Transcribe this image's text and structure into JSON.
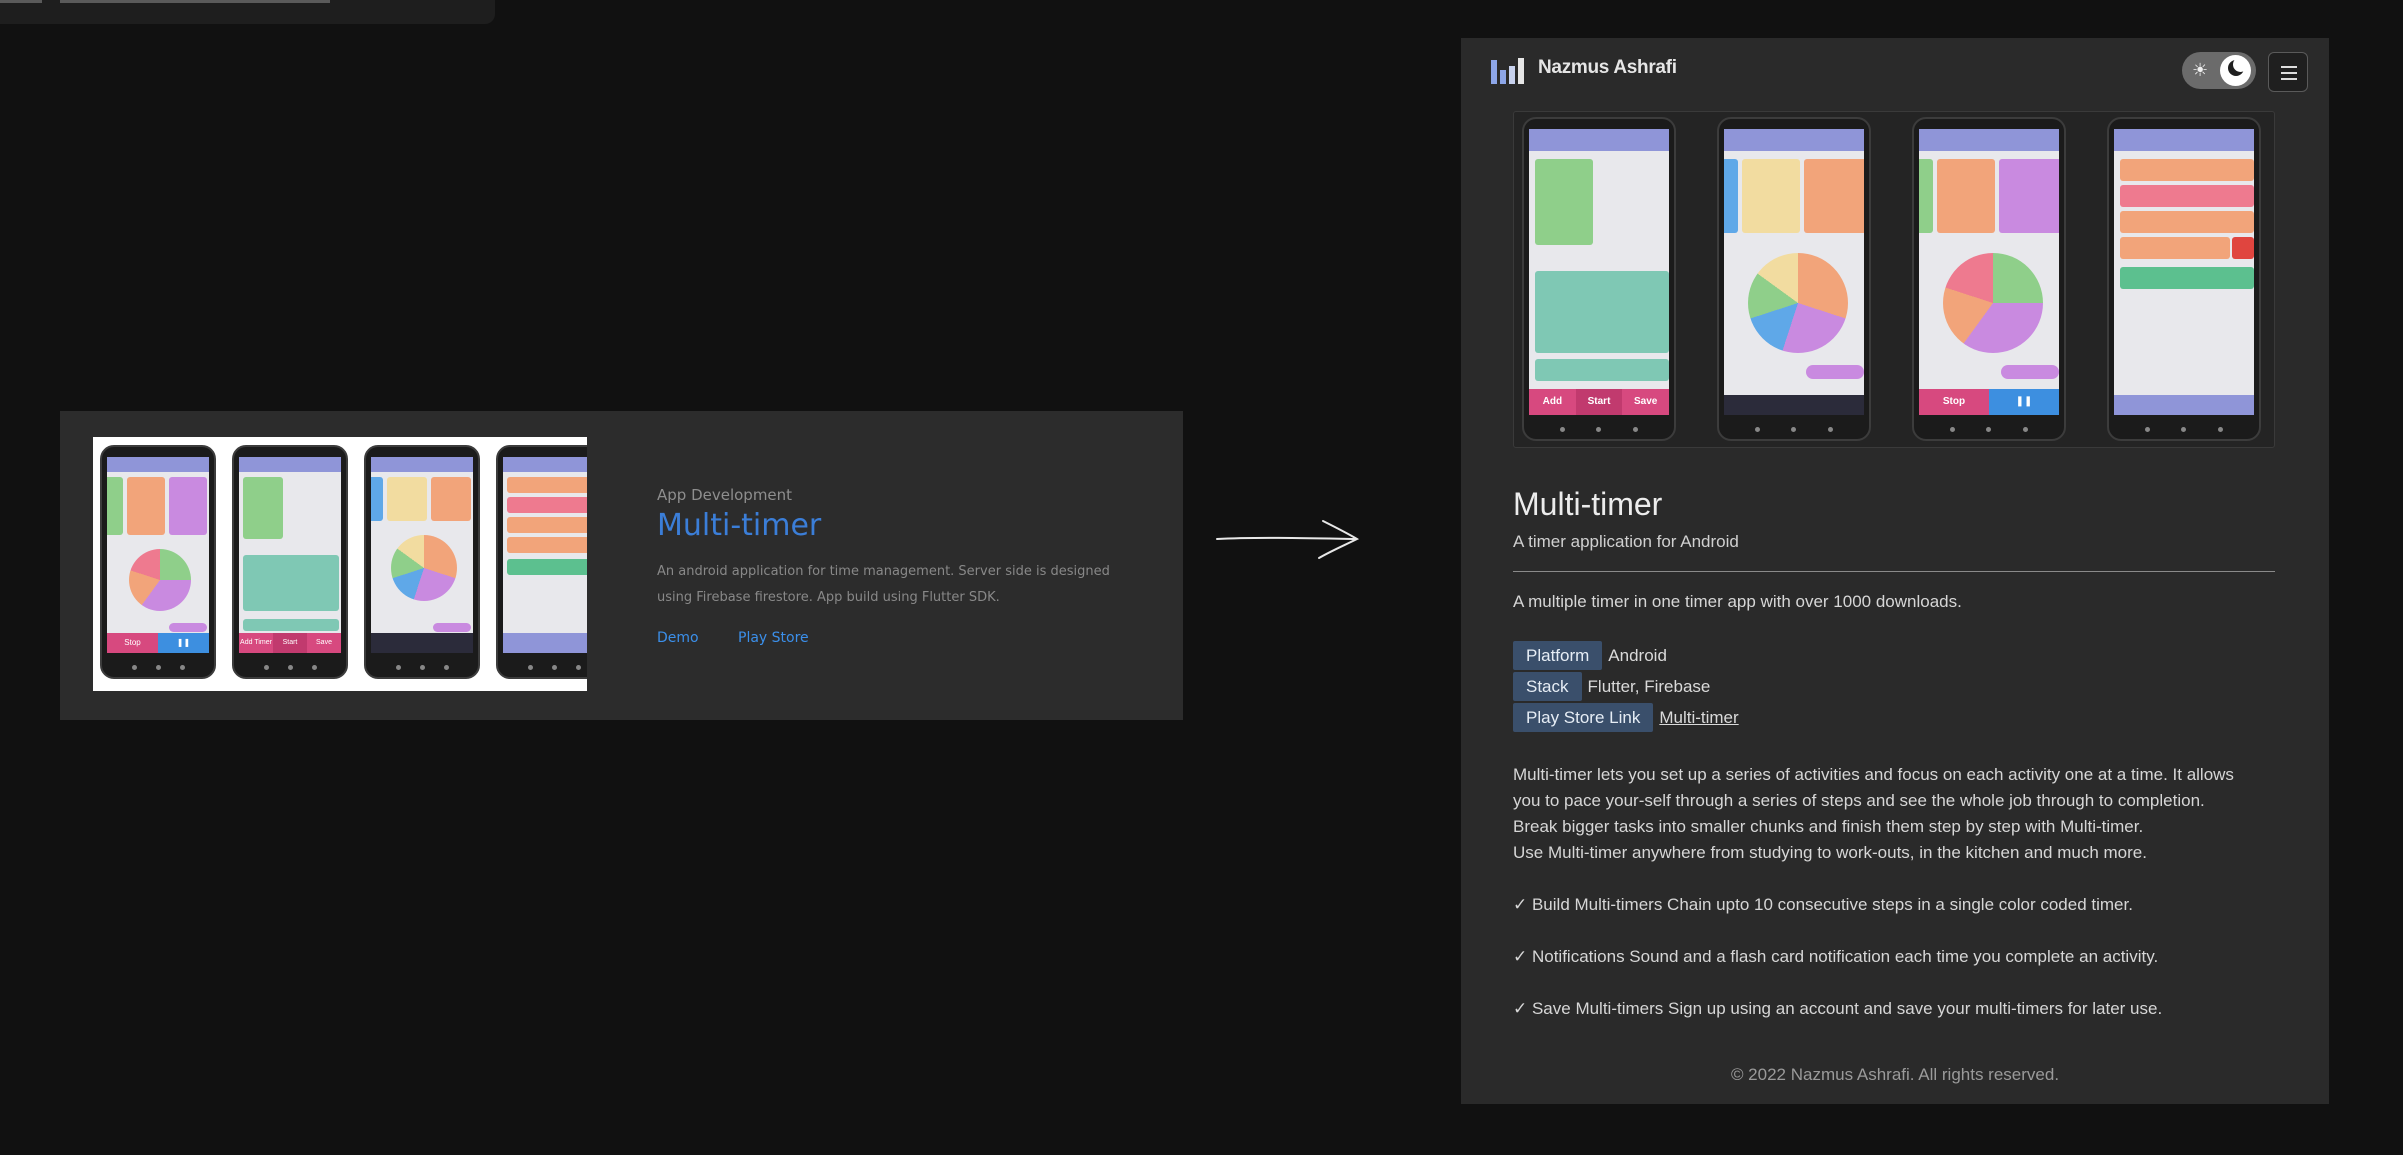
{
  "card": {
    "category": "App Development",
    "title": "Multi-timer",
    "description": "An android application for time management. Server side is designed using Firebase firestore. App build using Flutter SDK.",
    "links": [
      "Demo",
      "Play Store"
    ]
  },
  "site": {
    "name": "Nazmus Ashrafi",
    "theme_icons": [
      "sun-icon",
      "moon-icon"
    ],
    "menu_icon": "hamburger-menu-icon"
  },
  "project": {
    "title": "Multi-timer",
    "subtitle": "A timer application for Android",
    "lead": "A multiple timer in one timer app with over 1000 downloads.",
    "meta": {
      "platform_key": "Platform",
      "platform_val": "Android",
      "stack_key": "Stack",
      "stack_val": "Flutter, Firebase",
      "playstore_key": "Play Store Link",
      "playstore_val": "Multi-timer"
    },
    "paragraph_lines": [
      "Multi-timer lets you set up a series of activities and focus on each activity one at a time. It allows",
      "you to pace your-self through a series of steps and see the whole job through to completion.",
      "Break bigger tasks into smaller chunks and finish them step by step with Multi-timer.",
      "Use Multi-timer anywhere from studying to work-outs, in the kitchen and much more."
    ],
    "features": [
      "✓ Build Multi-timers Chain upto 10 consecutive steps in a single color coded timer.",
      "✓ Notifications Sound and a flash card notification each time you complete an activity.",
      "✓ Save Multi-timers Sign up using an account and save your multi-timers for later use."
    ],
    "footer": "© 2022 Nazmus Ashrafi. All rights reserved."
  },
  "screenshots": {
    "phone_labels": [
      "Add Timer",
      "Start",
      "Save",
      "Stop"
    ],
    "colors": {
      "appbar": "#8f95d8",
      "green": "#8fcf8a",
      "orange": "#f2a47a",
      "purple": "#c98ae0",
      "teal": "#7fc8b4",
      "pink": "#d7497f",
      "blue": "#3d8fe0"
    }
  }
}
